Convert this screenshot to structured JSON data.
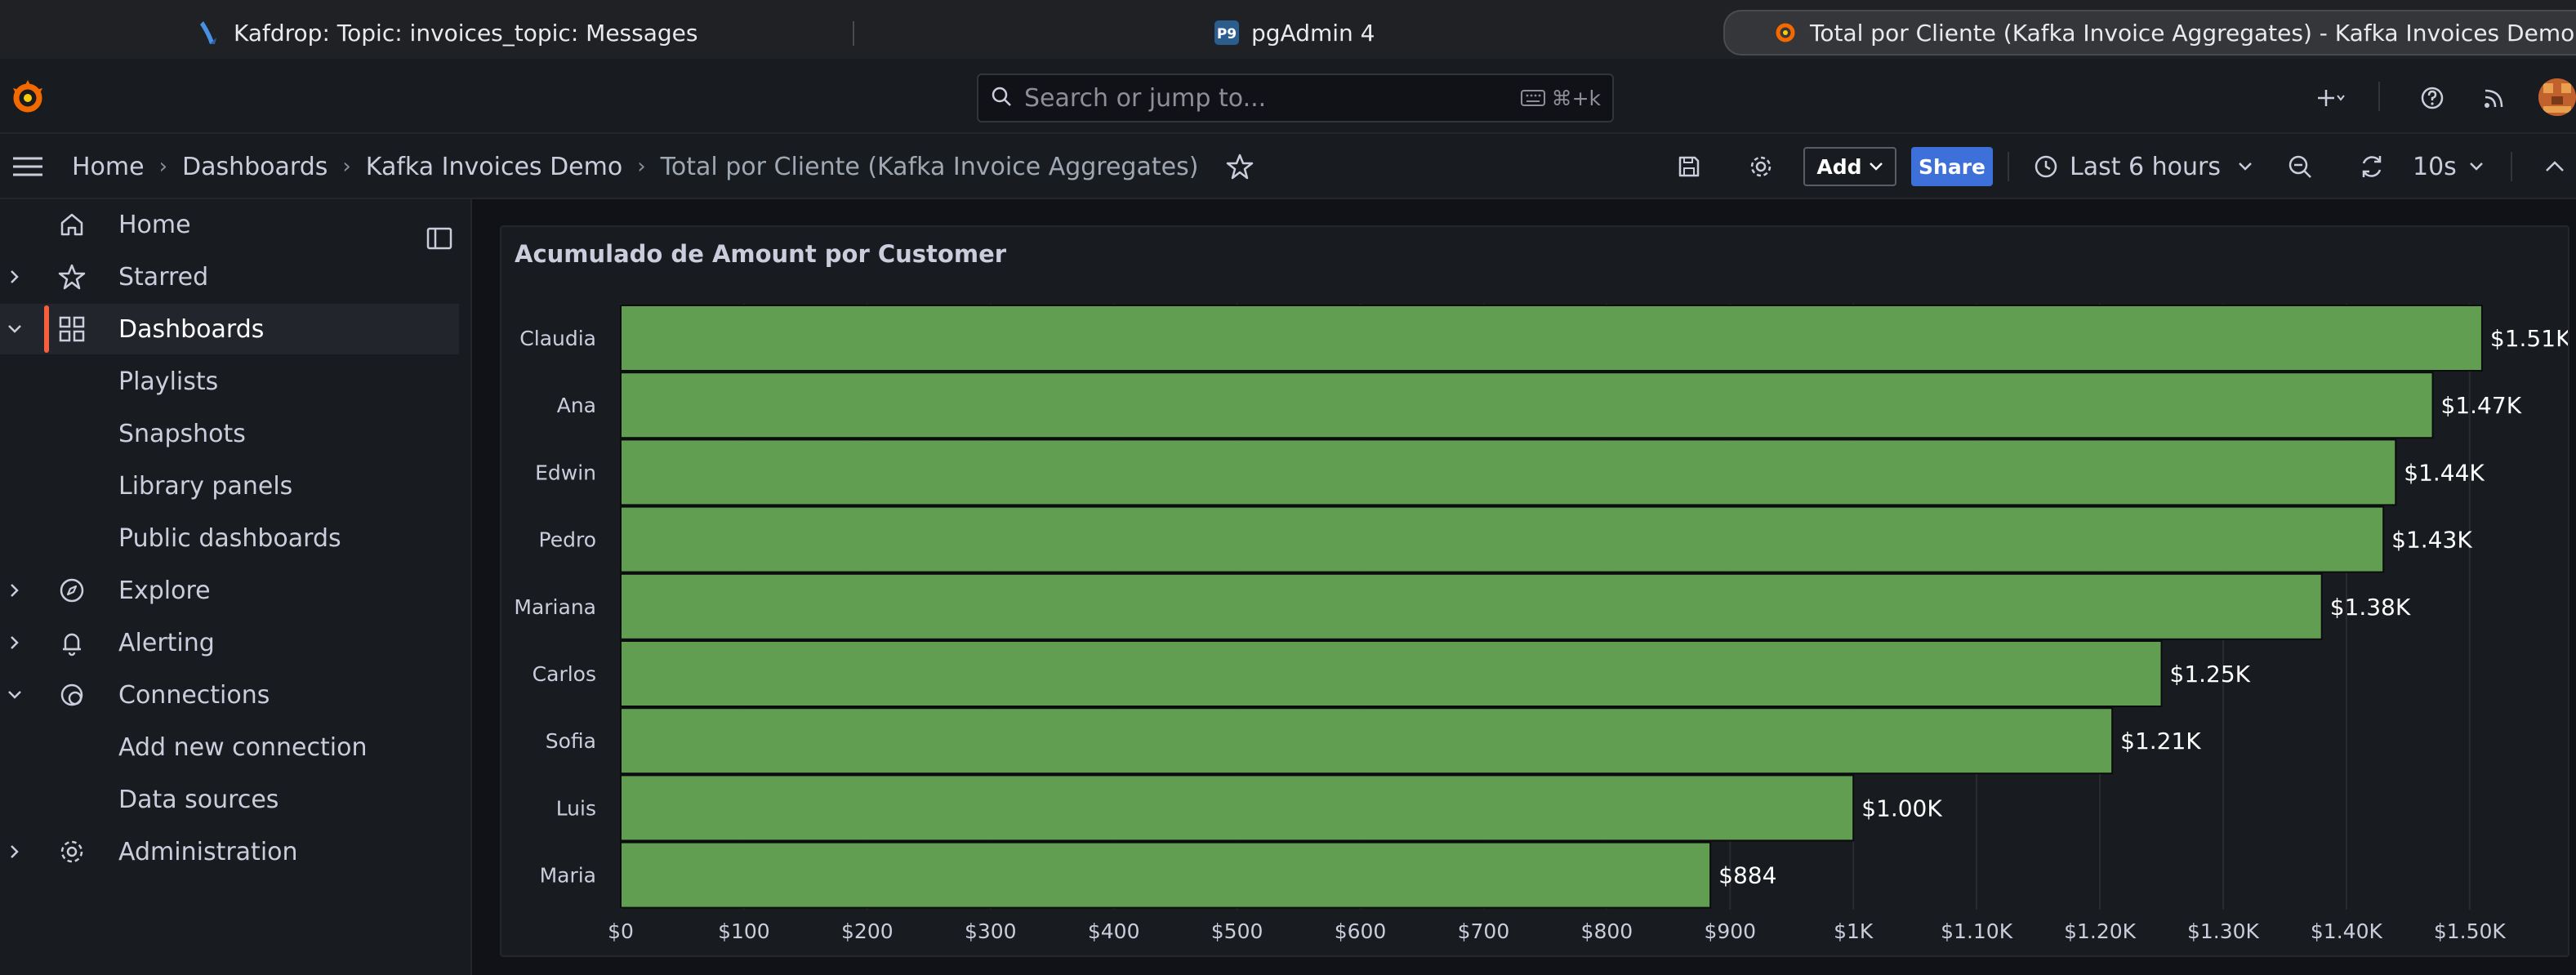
{
  "browser": {
    "tabs": [
      {
        "title": "Kafdrop: Topic: invoices_topic: Messages",
        "icon": "kafdrop-icon"
      },
      {
        "title": "pgAdmin 4",
        "icon": "pgadmin-icon"
      },
      {
        "title": "Total por Cliente (Kafka Invoice Aggregates) - Kafka Invoices Demo - Dashb...",
        "icon": "grafana-icon",
        "active": true
      }
    ]
  },
  "topbar": {
    "search_placeholder": "Search or jump to...",
    "search_shortcut": "⌘+k"
  },
  "breadcrumb": {
    "home": "Home",
    "dashboards": "Dashboards",
    "folder": "Kafka Invoices Demo",
    "current": "Total por Cliente (Kafka Invoice Aggregates)"
  },
  "toolbar": {
    "add_label": "Add",
    "share_label": "Share",
    "time_range": "Last 6 hours",
    "refresh_interval": "10s"
  },
  "sidebar": {
    "items": [
      {
        "label": "Home",
        "icon": "home-icon"
      },
      {
        "label": "Starred",
        "icon": "star-icon"
      },
      {
        "label": "Dashboards",
        "icon": "apps-icon",
        "active": true
      },
      {
        "label": "Playlists"
      },
      {
        "label": "Snapshots"
      },
      {
        "label": "Library panels"
      },
      {
        "label": "Public dashboards"
      },
      {
        "label": "Explore",
        "icon": "compass-icon"
      },
      {
        "label": "Alerting",
        "icon": "bell-icon"
      },
      {
        "label": "Connections",
        "icon": "connections-icon"
      },
      {
        "label": "Add new connection"
      },
      {
        "label": "Data sources"
      },
      {
        "label": "Administration",
        "icon": "cog-icon"
      }
    ]
  },
  "colors": {
    "bar": "#629e51",
    "accent": "#f55f3e",
    "share": "#3d71d9"
  },
  "chart_data": {
    "type": "bar",
    "orientation": "horizontal",
    "title": "Acumulado de Amount por Customer",
    "categories": [
      "Claudia",
      "Ana",
      "Edwin",
      "Pedro",
      "Mariana",
      "Carlos",
      "Sofia",
      "Luis",
      "Maria"
    ],
    "values": [
      1510,
      1470,
      1440,
      1430,
      1380,
      1250,
      1210,
      1000,
      884
    ],
    "value_labels": [
      "$1.51K",
      "$1.47K",
      "$1.44K",
      "$1.43K",
      "$1.38K",
      "$1.25K",
      "$1.21K",
      "$1.00K",
      "$884"
    ],
    "xticks": [
      0,
      100,
      200,
      300,
      400,
      500,
      600,
      700,
      800,
      900,
      1000,
      1100,
      1200,
      1300,
      1400,
      1500
    ],
    "xtick_labels": [
      "$0",
      "$100",
      "$200",
      "$300",
      "$400",
      "$500",
      "$600",
      "$700",
      "$800",
      "$900",
      "$1K",
      "$1.10K",
      "$1.20K",
      "$1.30K",
      "$1.40K",
      "$1.50K"
    ],
    "xlim": [
      0,
      1520
    ],
    "grid": true,
    "legend": "none"
  }
}
